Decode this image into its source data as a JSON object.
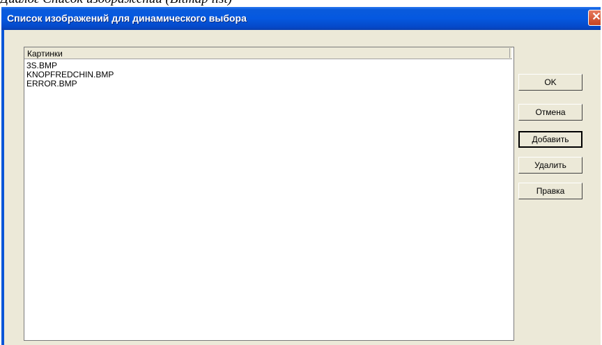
{
  "caption": "Диалог Список изображений (Bitmap list)",
  "window": {
    "title": "Список изображений для динамического выбора",
    "close_glyph": "✕"
  },
  "list": {
    "column_header": "Картинки",
    "items": [
      "3S.BMP",
      "KNOPFREDCHIN.BMP",
      "ERROR.BMP"
    ]
  },
  "buttons": {
    "ok": "OK",
    "cancel": "Отмена",
    "add": "Добавить",
    "delete": "Удалить",
    "edit": "Правка"
  }
}
